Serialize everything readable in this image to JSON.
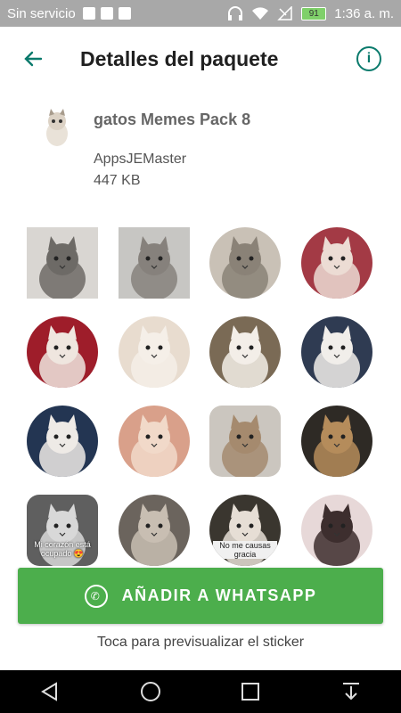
{
  "status_bar": {
    "carrier": "Sin servicio",
    "battery": "91",
    "time": "1:36 a. m.",
    "icons": [
      "notification-icon",
      "bluetooth-icon",
      "image-icon",
      "headphones-icon",
      "wifi-icon",
      "no-signal-icon",
      "battery-icon"
    ]
  },
  "header": {
    "title": "Detalles del paquete",
    "back_icon": "arrow-left-icon",
    "info_icon": "info-icon",
    "info_glyph": "i",
    "accent_color": "#0a7a6c"
  },
  "pack": {
    "name": "gatos Memes Pack 8",
    "publisher": "AppsJEMaster",
    "size": "447 KB"
  },
  "stickers": [
    {
      "shape": "square",
      "color": "#d9d6d2",
      "accent": "#6d6a66"
    },
    {
      "shape": "square",
      "color": "#c7c6c3",
      "accent": "#86817c"
    },
    {
      "shape": "circle",
      "color": "#c9c1b6",
      "accent": "#8a8277"
    },
    {
      "shape": "circle",
      "color": "#a33a45",
      "accent": "#ecdcd4"
    },
    {
      "shape": "circle",
      "color": "#9e1d2a",
      "accent": "#efe6df"
    },
    {
      "shape": "circle",
      "color": "#e8dccf",
      "accent": "#f5efe8"
    },
    {
      "shape": "circle",
      "color": "#7a6a55",
      "accent": "#f3eee8"
    },
    {
      "shape": "circle",
      "color": "#2f3b52",
      "accent": "#f1eeea"
    },
    {
      "shape": "circle",
      "color": "#233552",
      "accent": "#eeeae6"
    },
    {
      "shape": "circle",
      "color": "#d9a08a",
      "accent": "#f1d9c9"
    },
    {
      "shape": "rounded",
      "color": "#cbc6bf",
      "accent": "#a58a6e"
    },
    {
      "shape": "circle",
      "color": "#2e2a25",
      "accent": "#b58c5b"
    },
    {
      "shape": "rounded",
      "color": "#5f5f5f",
      "accent": "#d8d8d8",
      "caption": "Mi corazón está ocupado 😍"
    },
    {
      "shape": "circle",
      "color": "#6b645d",
      "accent": "#c8beb2"
    },
    {
      "shape": "circle",
      "color": "#3a362f",
      "accent": "#e6ded5",
      "caption": "No me causas gracia"
    },
    {
      "shape": "circle",
      "color": "#e7d8d8",
      "accent": "#3d2e2e"
    }
  ],
  "add_button": {
    "label": "AÑADIR A WHATSAPP",
    "icon": "whatsapp-icon",
    "color": "#4cae4c"
  },
  "hint": "Toca para previsualizar el sticker",
  "nav": {
    "buttons": [
      "back-triangle-icon",
      "home-circle-icon",
      "recents-square-icon",
      "download-arrow-icon"
    ]
  }
}
